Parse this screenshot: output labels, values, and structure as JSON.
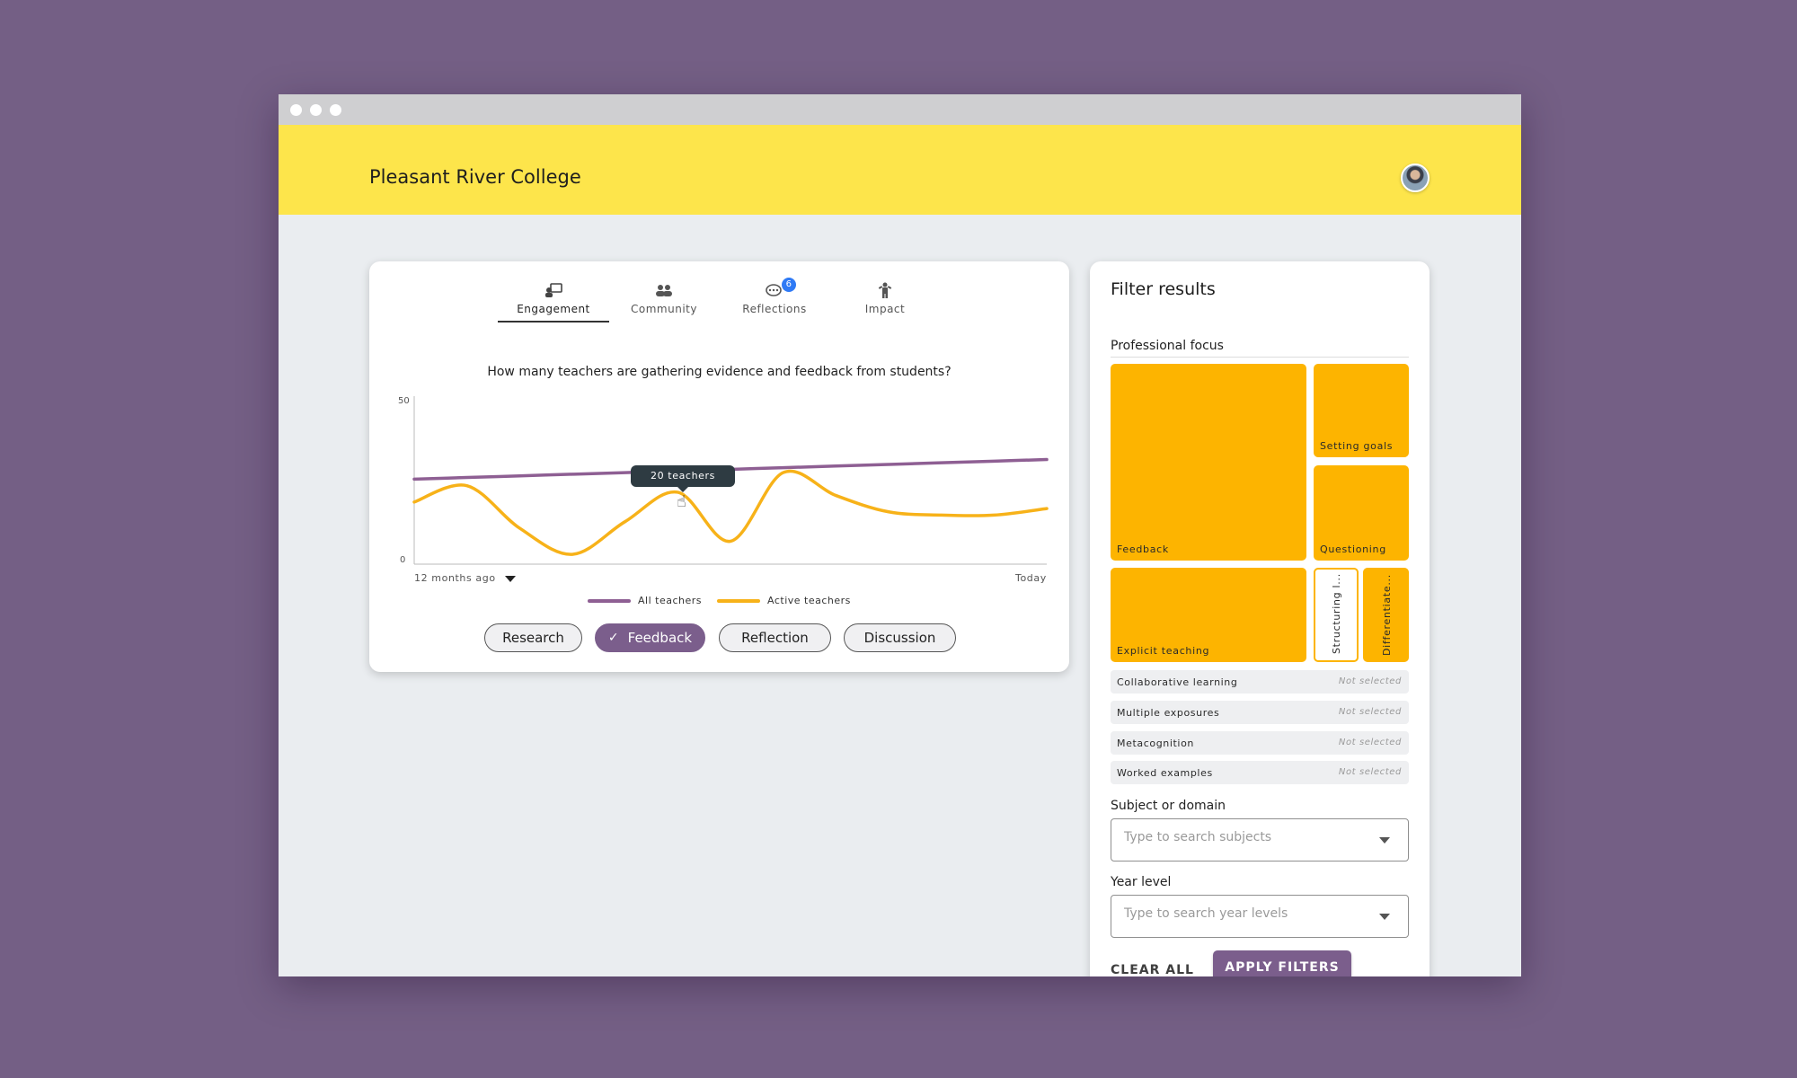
{
  "app": {
    "title": "Pleasant River College"
  },
  "tabs": [
    {
      "label": "Engagement",
      "icon": "engagement-icon",
      "active": true
    },
    {
      "label": "Community",
      "icon": "community-icon"
    },
    {
      "label": "Reflections",
      "icon": "reflections-icon",
      "badge": "6"
    },
    {
      "label": "Impact",
      "icon": "impact-icon"
    }
  ],
  "chart": {
    "question": "How many teachers are gathering evidence and feedback from students?",
    "tooltip": "20 teachers",
    "x_start_label": "12 months ago",
    "x_end_label": "Today",
    "y_max_label": "50",
    "y_min_label": "0"
  },
  "chart_data": {
    "type": "line",
    "x": [
      0,
      1,
      2,
      3,
      4,
      5,
      6,
      7,
      8,
      9,
      10,
      11,
      12
    ],
    "ylim": [
      0,
      50
    ],
    "series": [
      {
        "name": "All teachers",
        "color": "#8e5f93",
        "values": [
          26,
          26.5,
          27,
          27.5,
          28,
          28.5,
          29,
          29.5,
          30,
          30.5,
          31,
          31.5,
          32
        ]
      },
      {
        "name": "Active teachers",
        "color": "#f7b219",
        "values": [
          19,
          24,
          11,
          3,
          13,
          22,
          7,
          28,
          21,
          16,
          15,
          15,
          17
        ]
      }
    ],
    "tooltip_point": {
      "x": 5,
      "value": 20
    },
    "xlabel": "",
    "ylabel": ""
  },
  "pills": [
    {
      "label": "Research",
      "selected": false
    },
    {
      "label": "Feedback",
      "selected": true
    },
    {
      "label": "Reflection",
      "selected": false
    },
    {
      "label": "Discussion",
      "selected": false
    }
  ],
  "filter": {
    "title": "Filter results",
    "professional_focus_label": "Professional focus",
    "tiles": [
      {
        "label": "Feedback"
      },
      {
        "label": "Setting goals"
      },
      {
        "label": "Questioning"
      },
      {
        "label": "Explicit teaching"
      },
      {
        "label": "Structuring l..."
      },
      {
        "label": "Differentiate..."
      }
    ],
    "rows": [
      {
        "label": "Collaborative learning",
        "status": "Not selected"
      },
      {
        "label": "Multiple exposures",
        "status": "Not selected"
      },
      {
        "label": "Metacognition",
        "status": "Not selected"
      },
      {
        "label": "Worked examples",
        "status": "Not selected"
      }
    ],
    "subject_label": "Subject or domain",
    "subject_placeholder": "Type to search subjects",
    "year_label": "Year level",
    "year_placeholder": "Type to search year levels",
    "clear_label": "CLEAR ALL",
    "apply_label": "APPLY FILTERS"
  },
  "colors": {
    "accent": "#7b5e8c",
    "banner": "#fde54b",
    "tile": "#fdb400"
  }
}
